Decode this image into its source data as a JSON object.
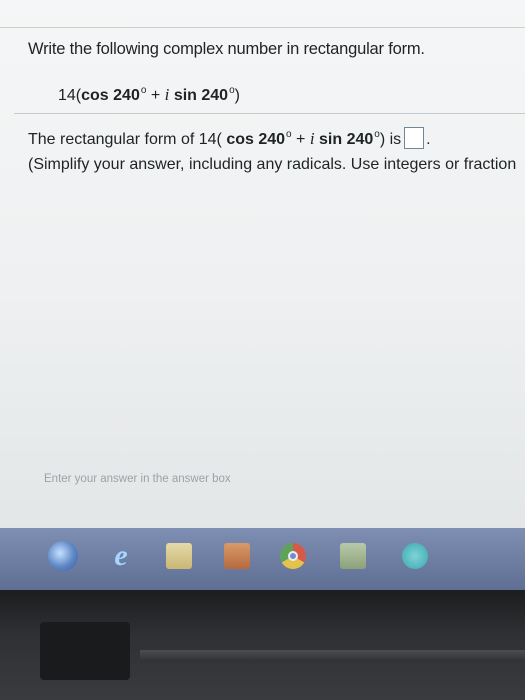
{
  "question": {
    "title": "Write the following complex number in rectangular form.",
    "expression": {
      "modulus": "14",
      "open": "(",
      "cos": "cos 240",
      "deg": "o",
      "plus": " + ",
      "i": "i",
      "sin": " sin 240",
      "close": ")"
    }
  },
  "answer": {
    "prefix": "The rectangular form of 14(",
    "cos": " cos 240",
    "deg": "o",
    "plus": " + ",
    "i": "i",
    "sin": " sin 240",
    "close": ") is",
    "period": ".",
    "hint": "(Simplify your answer, including any radicals. Use integers or fraction"
  },
  "status": {
    "text": "Enter your answer in the answer box"
  },
  "taskbar": {
    "icons": [
      "windows-start-icon",
      "internet-explorer-icon",
      "file-explorer-icon",
      "media-player-icon",
      "chrome-icon",
      "calculator-icon",
      "app-icon"
    ],
    "ie_glyph": "e"
  },
  "colors": {
    "page_bg": "#eef0f1",
    "text": "#1f2326",
    "answer_box_border": "#6f8797",
    "taskbar": "#6f7fa3"
  }
}
